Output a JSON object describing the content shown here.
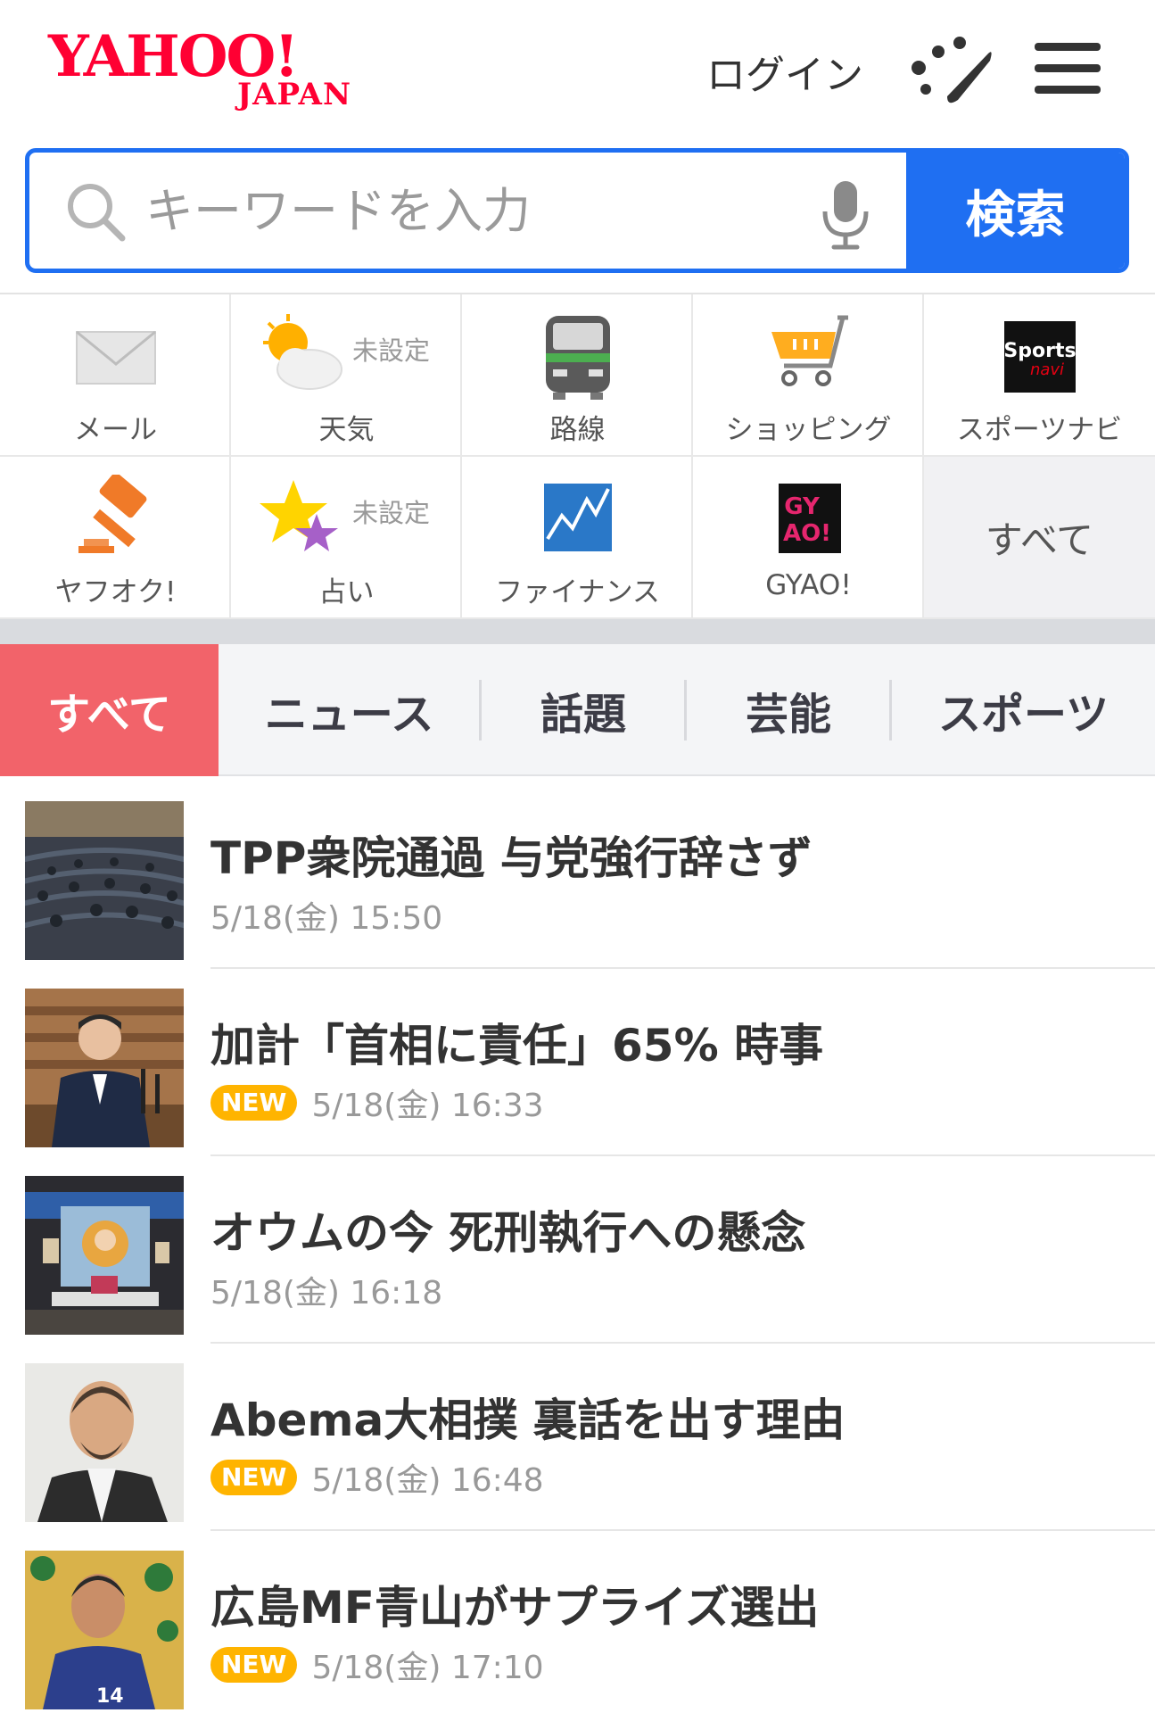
{
  "header": {
    "logo_text": "YAHOO!",
    "logo_sub": "JAPAN",
    "login_label": "ログイン",
    "dots_icon": "dots-brush-icon",
    "menu_icon": "hamburger-menu-icon"
  },
  "search": {
    "placeholder": "キーワードを入力",
    "value": "",
    "button_label": "検索",
    "icons": [
      "search-icon",
      "microphone-icon"
    ]
  },
  "services": [
    {
      "label": "メール",
      "icon": "mail-icon"
    },
    {
      "label": "天気",
      "icon": "weather-icon",
      "badge": "未設定"
    },
    {
      "label": "路線",
      "icon": "train-icon"
    },
    {
      "label": "ショッピング",
      "icon": "shopping-cart-icon"
    },
    {
      "label": "スポーツナビ",
      "icon": "sportsnavi-icon",
      "icon_text": [
        "Sports",
        "navi"
      ]
    },
    {
      "label": "ヤフオク!",
      "icon": "auction-gavel-icon"
    },
    {
      "label": "占い",
      "icon": "fortune-stars-icon",
      "badge": "未設定"
    },
    {
      "label": "ファイナンス",
      "icon": "finance-chart-icon"
    },
    {
      "label": "GYAO!",
      "icon": "gyao-icon",
      "icon_text": [
        "GY",
        "AO!"
      ]
    },
    {
      "label": "すべて"
    }
  ],
  "tabs": [
    {
      "label": "すべて",
      "active": true
    },
    {
      "label": "ニュース"
    },
    {
      "label": "話題"
    },
    {
      "label": "芸能"
    },
    {
      "label": "スポーツ"
    }
  ],
  "news": [
    {
      "title": "TPP衆院通過 与党強行辞さず",
      "time": "5/18(金) 15:50",
      "is_new": false,
      "thumb": "parliament-hall"
    },
    {
      "title": "加計「首相に責任」65% 時事",
      "time": "5/18(金) 16:33",
      "is_new": true,
      "badge": "NEW",
      "thumb": "prime-minister"
    },
    {
      "title": "オウムの今 死刑執行への懸念",
      "time": "5/18(金) 16:18",
      "is_new": false,
      "thumb": "altar-room"
    },
    {
      "title": "Abema大相撲 裏話を出す理由",
      "time": "5/18(金) 16:48",
      "is_new": true,
      "badge": "NEW",
      "thumb": "portrait-man"
    },
    {
      "title": "広島MF青山がサプライズ選出",
      "time": "5/18(金) 17:10",
      "is_new": true,
      "badge": "NEW",
      "thumb": "soccer-player"
    }
  ],
  "colors": {
    "brand_red": "#ff0033",
    "search_blue": "#1f6ff2",
    "active_tab": "#f2636a",
    "new_badge": "#ffb400"
  }
}
